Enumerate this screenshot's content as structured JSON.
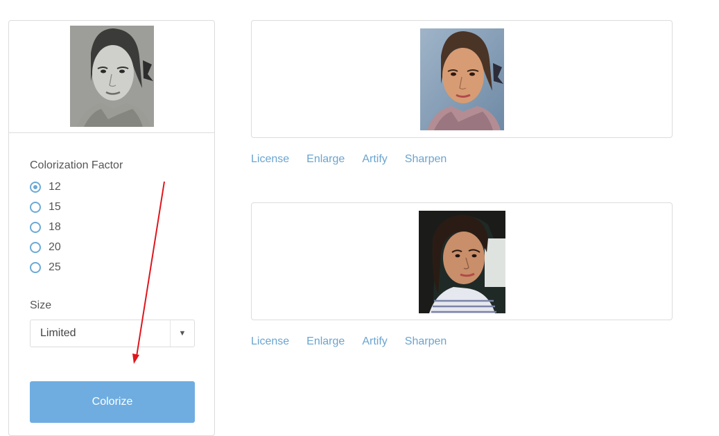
{
  "form": {
    "factor_label": "Colorization Factor",
    "factor_options": [
      "12",
      "15",
      "18",
      "20",
      "25"
    ],
    "factor_selected": "12",
    "size_label": "Size",
    "size_value": "Limited",
    "submit_label": "Colorize"
  },
  "results": [
    {
      "links": [
        "License",
        "Enlarge",
        "Artify",
        "Sharpen"
      ]
    },
    {
      "links": [
        "License",
        "Enlarge",
        "Artify",
        "Sharpen"
      ]
    }
  ],
  "colors": {
    "accent": "#6fade0",
    "link": "#6aa4cf",
    "annotation_arrow": "#e0141b"
  },
  "icons": {
    "select_arrow": "chevron-down-icon"
  }
}
